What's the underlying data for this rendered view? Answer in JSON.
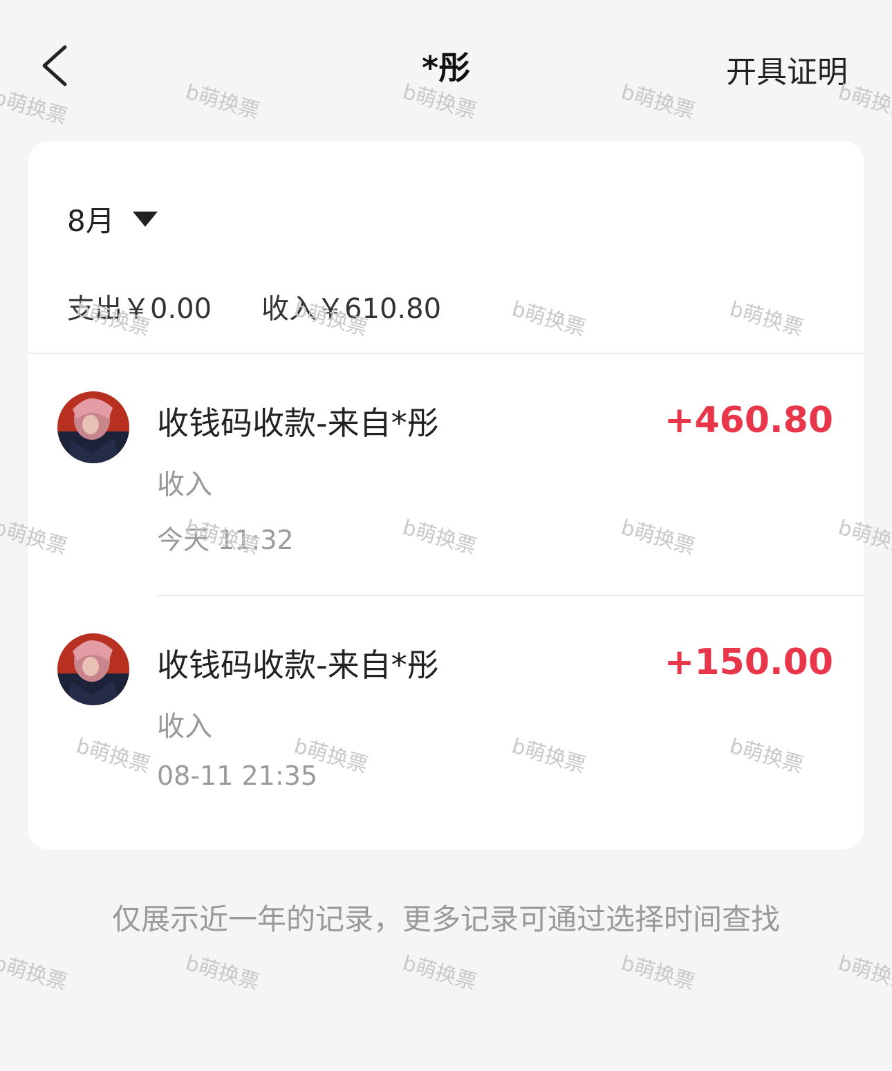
{
  "header": {
    "title": "*彤",
    "action_label": "开具证明"
  },
  "filter": {
    "month": "8月"
  },
  "summary": {
    "expense": "支出￥0.00",
    "income": "收入￥610.80"
  },
  "transactions": [
    {
      "title": "收钱码收款-来自*彤",
      "type": "收入",
      "time": "今天 11:32",
      "amount": "+460.80"
    },
    {
      "title": "收钱码收款-来自*彤",
      "type": "收入",
      "time": "08-11 21:35",
      "amount": "+150.00"
    }
  ],
  "footer": {
    "note": "仅展示近一年的记录，更多记录可通过选择时间查找"
  },
  "watermark": "b萌换票",
  "colors": {
    "amount": "#e8364a",
    "background": "#f5f5f5",
    "card": "#ffffff"
  }
}
